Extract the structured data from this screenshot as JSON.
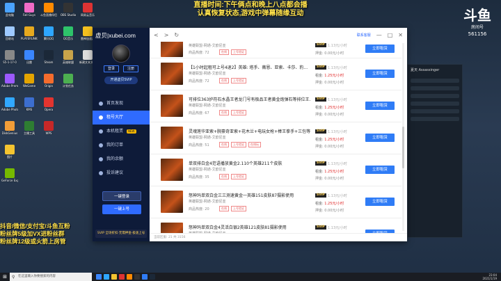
{
  "overlay": {
    "banner_line1": "直播时间:下午俩点和晚上八点都会播",
    "banner_line2": "认真恢复状态,游戏中弹幕随缘互动",
    "platform_logo": "斗鱼",
    "platform_sub": "房间号",
    "room_id": "561156",
    "fan_line1": "抖音/微信/支付宝/斗鱼互粉",
    "fan_line2": "粉丝牌5级加VX进粉丝群",
    "fan_line3": "粉丝牌12级或火箭上房管"
  },
  "desktop_icons": [
    {
      "label": "此电脑",
      "color": "#4aa3ff"
    },
    {
      "label": "Fall Guys",
      "color": "#f06bc6"
    },
    {
      "label": "斗鱼直播伴侣",
      "color": "#ff8a00"
    },
    {
      "label": "OBS Studio",
      "color": "#333333"
    },
    {
      "label": "网易云音乐",
      "color": "#d33"
    },
    {
      "label": "雷神加速器",
      "color": "#f4c11f"
    },
    {
      "label": "新建文本文档",
      "color": "#dddddd"
    },
    {
      "label": "回收站",
      "color": "#9ec9ff"
    },
    {
      "label": "PLAYERUNKNOWN'S BATTLEGR...",
      "color": "#e6a91e"
    },
    {
      "label": "腾讯QQ",
      "color": "#2ea6ff"
    },
    {
      "label": "QQ音乐",
      "color": "#2ec46a"
    },
    {
      "label": "S5-1-17-0",
      "color": "#888888"
    },
    {
      "label": "迅雷",
      "color": "#3a86ff"
    },
    {
      "label": "Adobe Premiere",
      "color": "#9b59ff"
    },
    {
      "label": "Steam",
      "color": "#1b2838"
    },
    {
      "label": "Adobe Photoshop",
      "color": "#31a8ff"
    },
    {
      "label": "WeGame",
      "color": "#e4a400"
    },
    {
      "label": "DiskGenius",
      "color": "#f29d38"
    },
    {
      "label": "KMS",
      "color": "#3c6ecf"
    },
    {
      "label": "Origin",
      "color": "#f56c2d"
    },
    {
      "label": "英雄联盟",
      "color": "#c9a44a"
    },
    {
      "label": "图片",
      "color": "#f4c430"
    },
    {
      "label": "主播工具",
      "color": "#2e7d32"
    },
    {
      "label": "Opera",
      "color": "#e3342f"
    },
    {
      "label": "计划任务",
      "color": "#4caf50"
    },
    {
      "label": "GeForce Experience",
      "color": "#76b900"
    },
    {
      "label": "WPS",
      "color": "#c62828"
    }
  ],
  "window": {
    "brand": "虚贝|xubei.com",
    "auth_register": "登录",
    "auth_login": "注册",
    "vip_button": "开通虚贝SVIP",
    "menu": [
      {
        "label": "首页发现",
        "active": false,
        "badge": ""
      },
      {
        "label": "租号大厅",
        "active": true,
        "badge": ""
      },
      {
        "label": "本机租赁",
        "active": false,
        "badge": "NEW"
      },
      {
        "label": "我的订单",
        "active": false,
        "badge": ""
      },
      {
        "label": "我的余额",
        "active": false,
        "badge": ""
      },
      {
        "label": "投诉建议",
        "active": false,
        "badge": ""
      }
    ],
    "login_button_1": "一键登录",
    "login_button_2": "一键上号",
    "svip_bar": "SVIP 全场折扣·无需押金·极速上号",
    "topbar_back": "<",
    "topbar_forward": ">",
    "topbar_refresh": "↻",
    "customer_service": "联系客服",
    "minimize": "—",
    "maximize": "□",
    "close": "✕",
    "footer": "当前区服: 21   共 3156"
  },
  "listings": [
    {
      "title": "",
      "sub": "英雄联盟-网通-艾欧尼亚",
      "heat": "商品热度: 72",
      "tags": [
        "在线",
        "上号验证"
      ],
      "svip_price": "1.13元/小时",
      "price": "1.25元/小时",
      "deposit": "押金: 0.00元/小时",
      "button": "立即租赁"
    },
    {
      "title": "【1小时起租可上号4退2】英雄: 塔手、薇恩、亚索、卡莎、豹...",
      "sub": "英雄联盟-网通-艾欧尼亚",
      "heat": "商品热度: 72",
      "tags": [
        "在线",
        "上号验证"
      ],
      "svip_price": "1.13元/小时",
      "price": "1.25元/小时",
      "deposit": "押金: 0.00元/小时",
      "button": "立即租赁"
    },
    {
      "title": "可排位363护符石水晶王者龙门号有极品王者黄金炮弹石等排位王...",
      "sub": "英雄联盟-网通-艾欧尼亚",
      "heat": "商品热度: 67",
      "tags": [
        "在线",
        "上号验证"
      ],
      "svip_price": "1.13元/小时",
      "price": "1.25元/小时",
      "deposit": "押金: 0.00元/小时",
      "button": "立即租赁"
    },
    {
      "title": "灵魂莲华亚索+腕豪奇亚索+花木兰+电玩女枪+棒王拳手+三包等...",
      "sub": "英雄联盟-网通-艾欧尼亚",
      "heat": "商品热度: 51",
      "tags": [
        "在线",
        "上号验证",
        "在线玩"
      ],
      "svip_price": "1.13元/小时",
      "price": "1.25元/小时",
      "deposit": "押金: 0.00元/小时",
      "button": "立即租赁"
    },
    {
      "title": "单双排白金4范语播放黄金2.110个英雄211个皮肤",
      "sub": "英雄联盟-网通-艾欧尼亚",
      "heat": "商品热度: 35",
      "tags": [
        "在线",
        "上号验证"
      ],
      "svip_price": "1.13元/小时",
      "price": "1.25元/小时",
      "deposit": "押金: 0.00元/小时",
      "button": "立即租赁"
    },
    {
      "title": "怒神玛单双白金三三测速黄金一英雄151皮肤87摄影使用",
      "sub": "英雄联盟-网通-艾欧尼亚",
      "heat": "商品热度: 20",
      "tags": [
        "在线",
        "上号验证"
      ],
      "svip_price": "1.13元/小时",
      "price": "1.25元/小时",
      "deposit": "押金: 0.00元/小时",
      "button": "立即租赁"
    },
    {
      "title": "怒神玛单双白金4灵活白银2英雄121皮肤81摄影使用",
      "sub": "英雄联盟-网通-艾欧尼亚",
      "heat": "",
      "tags": [],
      "svip_price": "1.13元/小时",
      "price": "1.25元/小时",
      "deposit": "",
      "button": "立即租赁"
    }
  ],
  "chat": {
    "title": "夏天 Assassinger"
  },
  "taskbar": {
    "search_placeholder": "在这里输入你要搜索的内容",
    "time": "23:04",
    "date": "2021/1/19"
  }
}
